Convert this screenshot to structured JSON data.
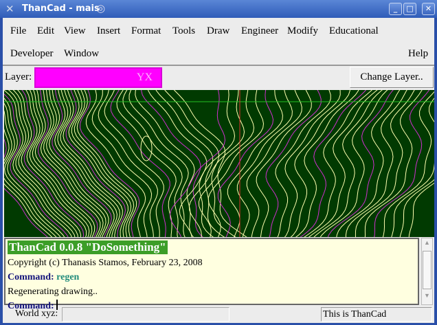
{
  "window": {
    "title": "ThanCad - mais"
  },
  "menu": {
    "row1": [
      "File",
      "Edit",
      "View",
      "Insert",
      "Format",
      "Tools",
      "Draw",
      "Engineer",
      "Modify",
      "Educational"
    ],
    "row2": [
      "Developer",
      "Window"
    ],
    "help": "Help"
  },
  "layer": {
    "label": "Layer:",
    "value": "YX",
    "color": "#ff00ff",
    "change_button": "Change Layer.."
  },
  "canvas": {
    "background": "#013a01",
    "contour_color": "#ffffb0",
    "index_color": "#d030d0"
  },
  "console": {
    "header": "ThanCad 0.0.8 \"DoSomething\"",
    "copyright": "Copyright (c) Thanasis Stamos,   February 23, 2008",
    "prompt": "Command:",
    "command1": "regen",
    "output1": "Regenerating drawing.."
  },
  "status": {
    "world_label": "World xyz:",
    "world_value": "",
    "message": "This is ThanCad"
  }
}
